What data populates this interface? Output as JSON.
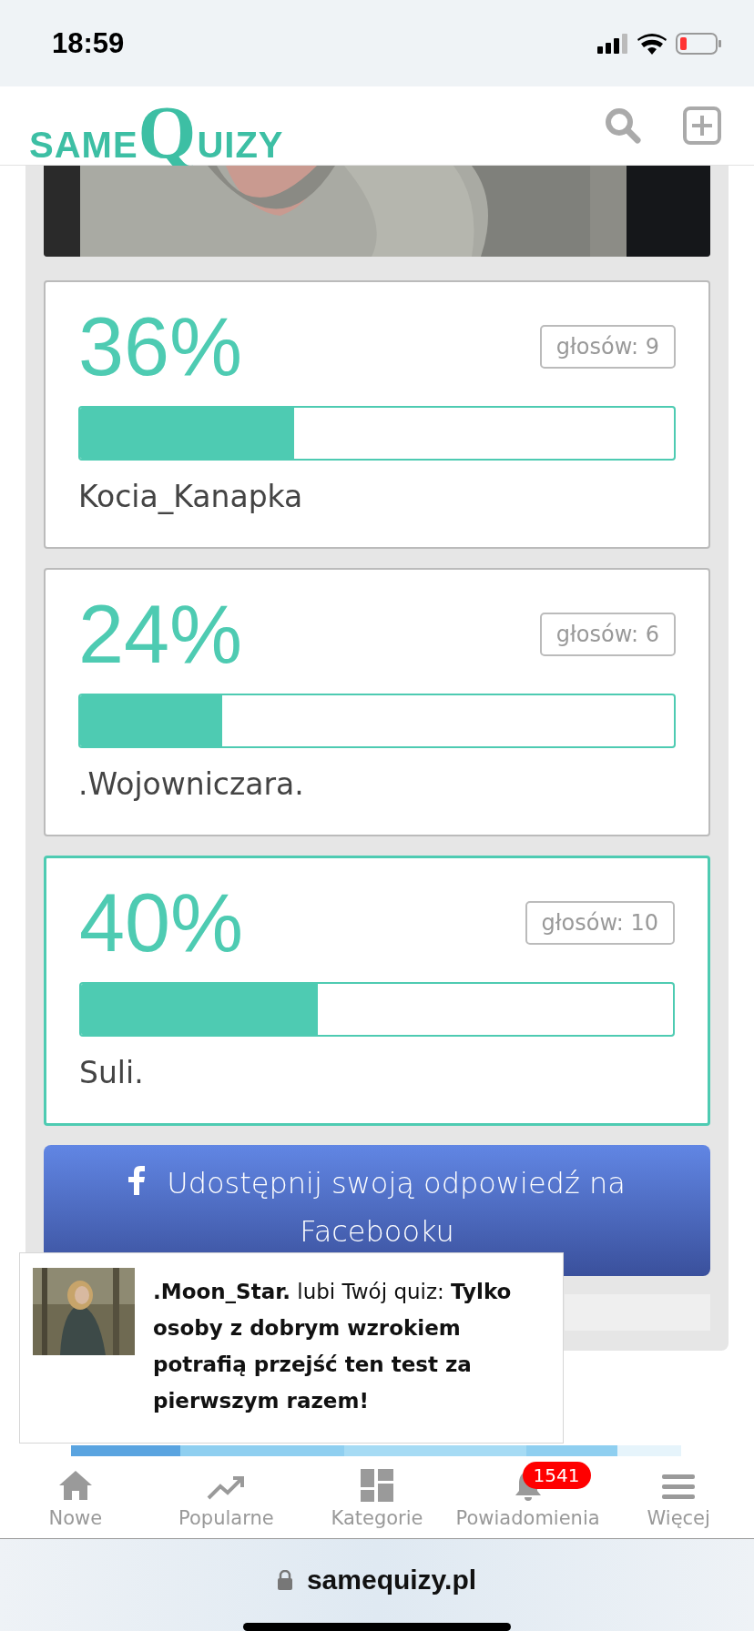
{
  "status_bar": {
    "time": "18:59"
  },
  "header": {
    "logo": [
      "SAME",
      "Q",
      "UIZY"
    ]
  },
  "results": [
    {
      "percent": "36%",
      "votes": "głosów: 9",
      "level": 0.36,
      "name": "Kocia_Kanapka",
      "selected": false
    },
    {
      "percent": "24%",
      "votes": "głosów: 6",
      "level": 0.24,
      "name": ".Wojowniczara.",
      "selected": false
    },
    {
      "percent": "40%",
      "votes": "głosów: 10",
      "level": 0.4,
      "name": "Suli.",
      "selected": true
    }
  ],
  "share_button": {
    "label": "Udostępnij swoją odpowiedź na Facebooku"
  },
  "notification": {
    "text": "**.Moon_Star.** lubi Twój quiz: **Tylko osoby z dobrym wzrokiem potrafią przejść ten test za pierwszym razem!**"
  },
  "bottom_nav": [
    {
      "label": "Nowe"
    },
    {
      "label": "Popularne"
    },
    {
      "label": "Kategorie"
    },
    {
      "label": "Powiadomienia",
      "badge": "1541"
    },
    {
      "label": "Więcej"
    }
  ],
  "browser": {
    "url": "samequizy.pl"
  }
}
